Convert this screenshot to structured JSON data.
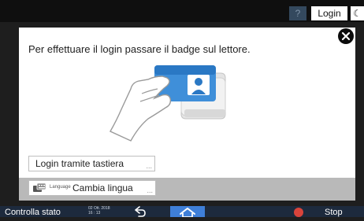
{
  "topbar": {
    "help_icon": "question-icon",
    "help_glyph": "?",
    "login_label": "Login",
    "theme_icon": "moon-icon",
    "theme_glyph": "☾"
  },
  "dialog": {
    "close_icon": "close-icon",
    "message": "Per effettuare il login passare il badge sul lettore.",
    "keyboard_login_label": "Login tramite tastiera",
    "more_glyph": "...",
    "language": {
      "icon": "keyboard-language-icon",
      "small_label": "Language",
      "label": "Cambia lingua"
    }
  },
  "bottombar": {
    "status_label": "Controlla stato",
    "date": "02 Ott. 2018",
    "time": "16 : 13",
    "back_icon": "back-arrow-icon",
    "home_icon": "home-icon",
    "stop_icon": "stop-icon",
    "stop_label": "Stop"
  },
  "colors": {
    "dialog_bg": "#ffffff",
    "band_bg": "#b9b9b9",
    "accent_blue": "#3f7fd8",
    "stop_red": "#d9443b",
    "help_bg": "#34495e"
  }
}
